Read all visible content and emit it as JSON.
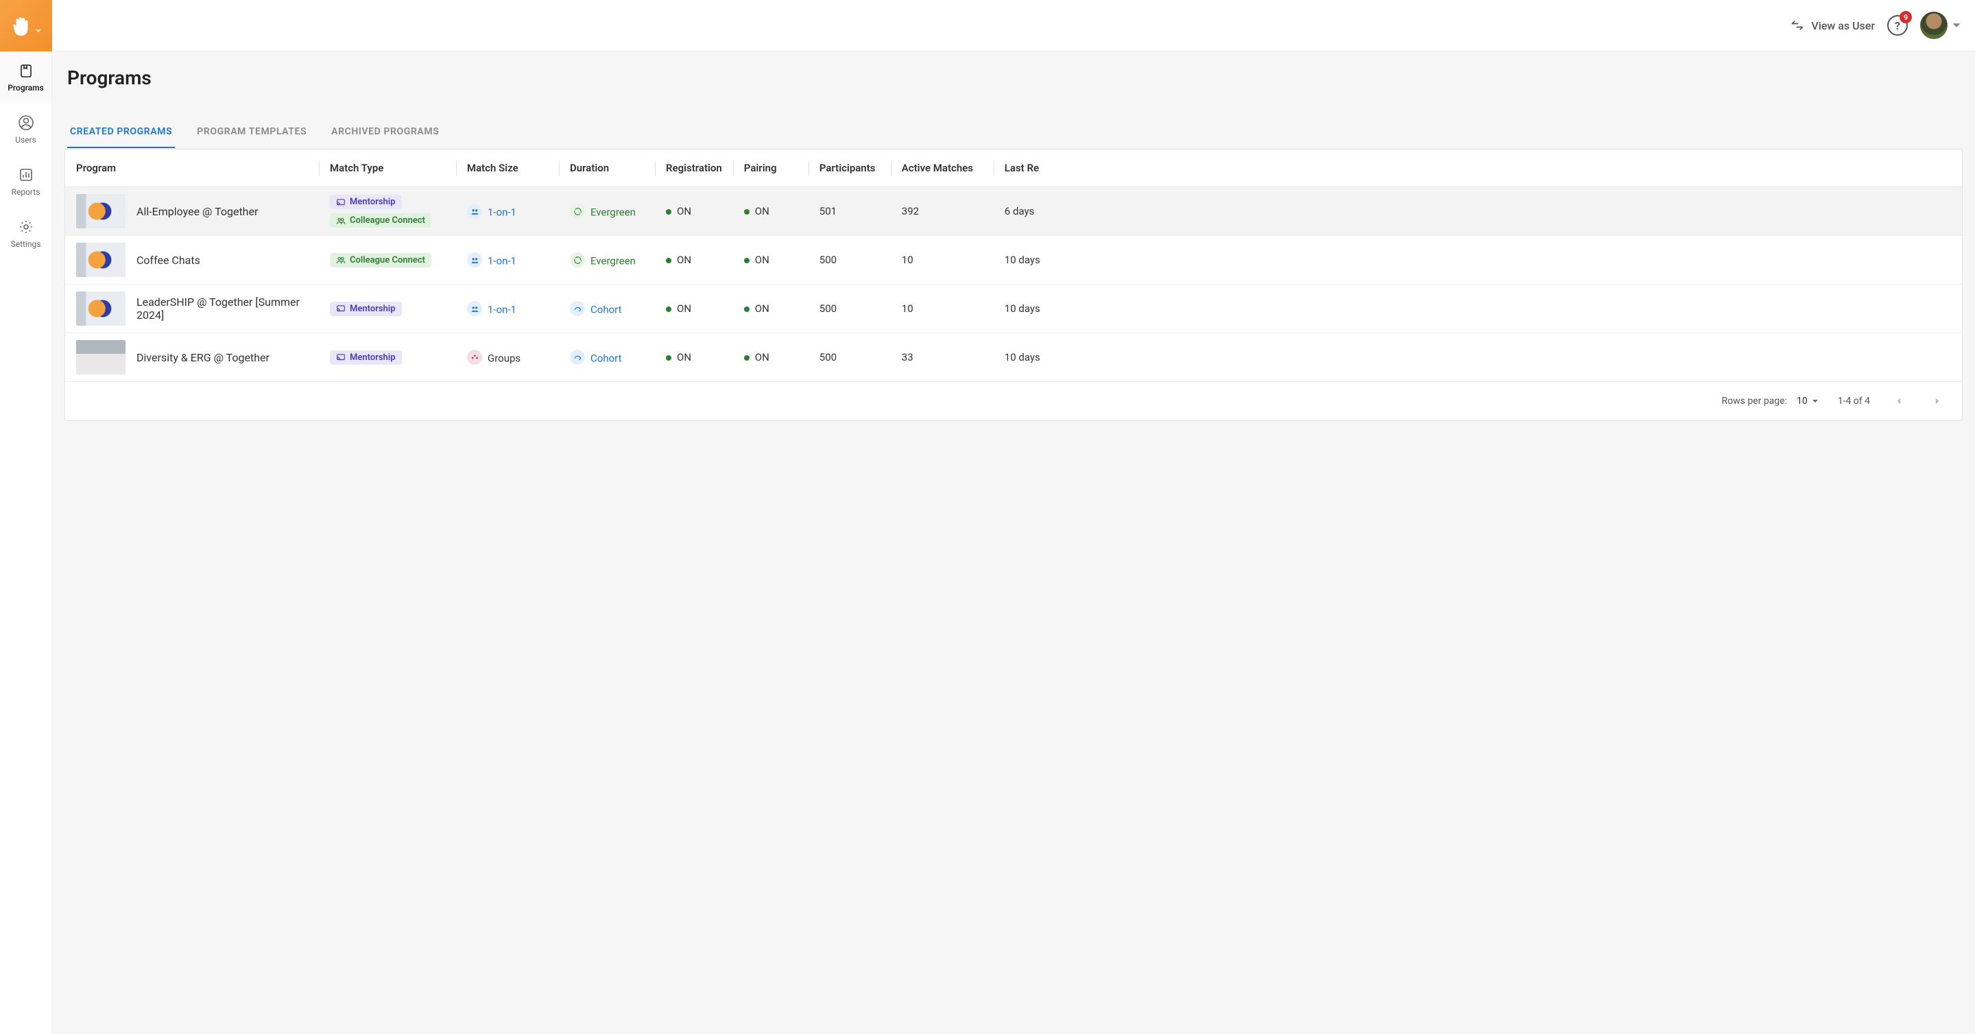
{
  "sidebar": {
    "items": [
      {
        "label": "Programs",
        "active": true
      },
      {
        "label": "Users",
        "active": false
      },
      {
        "label": "Reports",
        "active": false
      },
      {
        "label": "Settings",
        "active": false
      }
    ]
  },
  "topbar": {
    "view_as_label": "View as User",
    "help_badge": "9"
  },
  "page": {
    "title": "Programs"
  },
  "tabs": [
    {
      "label": "CREATED PROGRAMS",
      "active": true
    },
    {
      "label": "PROGRAM TEMPLATES",
      "active": false
    },
    {
      "label": "ARCHIVED PROGRAMS",
      "active": false
    }
  ],
  "columns": {
    "program": "Program",
    "match_type": "Match Type",
    "match_size": "Match Size",
    "duration": "Duration",
    "registration": "Registration",
    "pairing": "Pairing",
    "participants": "Participants",
    "active_matches": "Active Matches",
    "last": "Last Re"
  },
  "type_labels": {
    "mentorship": "Mentorship",
    "colleague": "Colleague Connect"
  },
  "size_labels": {
    "one_on_one": "1-on-1",
    "groups": "Groups"
  },
  "duration_labels": {
    "evergreen": "Evergreen",
    "cohort": "Cohort"
  },
  "status_labels": {
    "on": "ON"
  },
  "rows": [
    {
      "name": "All-Employee @ Together",
      "types": [
        "mentorship",
        "colleague"
      ],
      "size": "one_on_one",
      "duration": "evergreen",
      "registration": "on",
      "pairing": "on",
      "participants": "501",
      "active_matches": "392",
      "last": "6 days",
      "thumb": "default",
      "selected": true
    },
    {
      "name": "Coffee Chats",
      "types": [
        "colleague"
      ],
      "size": "one_on_one",
      "duration": "evergreen",
      "registration": "on",
      "pairing": "on",
      "participants": "500",
      "active_matches": "10",
      "last": "10 days",
      "thumb": "default",
      "selected": false
    },
    {
      "name": "LeaderSHIP @ Together [Summer 2024]",
      "types": [
        "mentorship"
      ],
      "size": "one_on_one",
      "duration": "cohort",
      "registration": "on",
      "pairing": "on",
      "participants": "500",
      "active_matches": "10",
      "last": "10 days",
      "thumb": "default",
      "selected": false
    },
    {
      "name": "Diversity & ERG @ Together",
      "types": [
        "mentorship"
      ],
      "size": "groups",
      "duration": "cohort",
      "registration": "on",
      "pairing": "on",
      "participants": "500",
      "active_matches": "33",
      "last": "10 days",
      "thumb": "meeting",
      "selected": false
    }
  ],
  "pagination": {
    "rows_per_page_label": "Rows per page:",
    "rows_per_page_value": "10",
    "range_label": "1-4 of 4"
  }
}
